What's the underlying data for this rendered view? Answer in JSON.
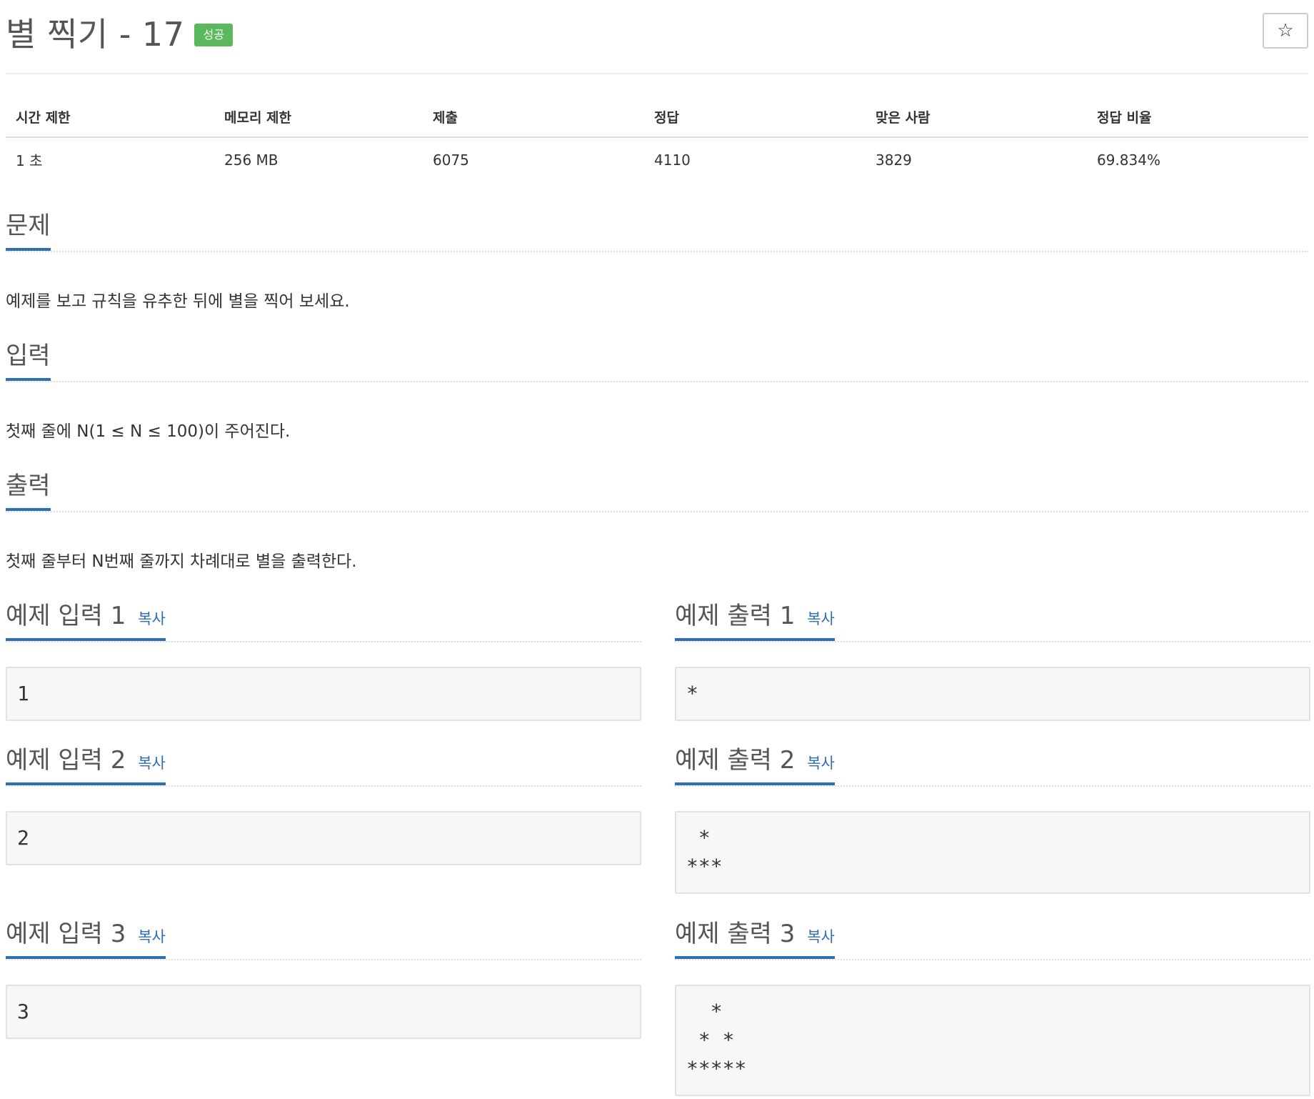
{
  "header": {
    "title": "별 찍기 - 17",
    "badge": "성공",
    "star_icon": "☆"
  },
  "info": {
    "headers": [
      "시간 제한",
      "메모리 제한",
      "제출",
      "정답",
      "맞은 사람",
      "정답 비율"
    ],
    "values": [
      "1 초",
      "256 MB",
      "6075",
      "4110",
      "3829",
      "69.834%"
    ]
  },
  "problem": {
    "title": "문제",
    "text": "예제를 보고 규칙을 유추한 뒤에 별을 찍어 보세요."
  },
  "input": {
    "title": "입력",
    "text": "첫째 줄에 N(1 ≤ N ≤ 100)이 주어진다."
  },
  "output": {
    "title": "출력",
    "text": "첫째 줄부터 N번째 줄까지 차례대로 별을 출력한다."
  },
  "copy_label": "복사",
  "samples": [
    {
      "input_title": "예제 입력 1",
      "input": "1",
      "output_title": "예제 출력 1",
      "output": "*"
    },
    {
      "input_title": "예제 입력 2",
      "input": "2",
      "output_title": "예제 출력 2",
      "output": " *\n***"
    },
    {
      "input_title": "예제 입력 3",
      "input": "3",
      "output_title": "예제 출력 3",
      "output": "  *\n * *\n*****"
    }
  ],
  "colors": {
    "accent": "#2f6db5",
    "badge": "#5cb85c"
  }
}
